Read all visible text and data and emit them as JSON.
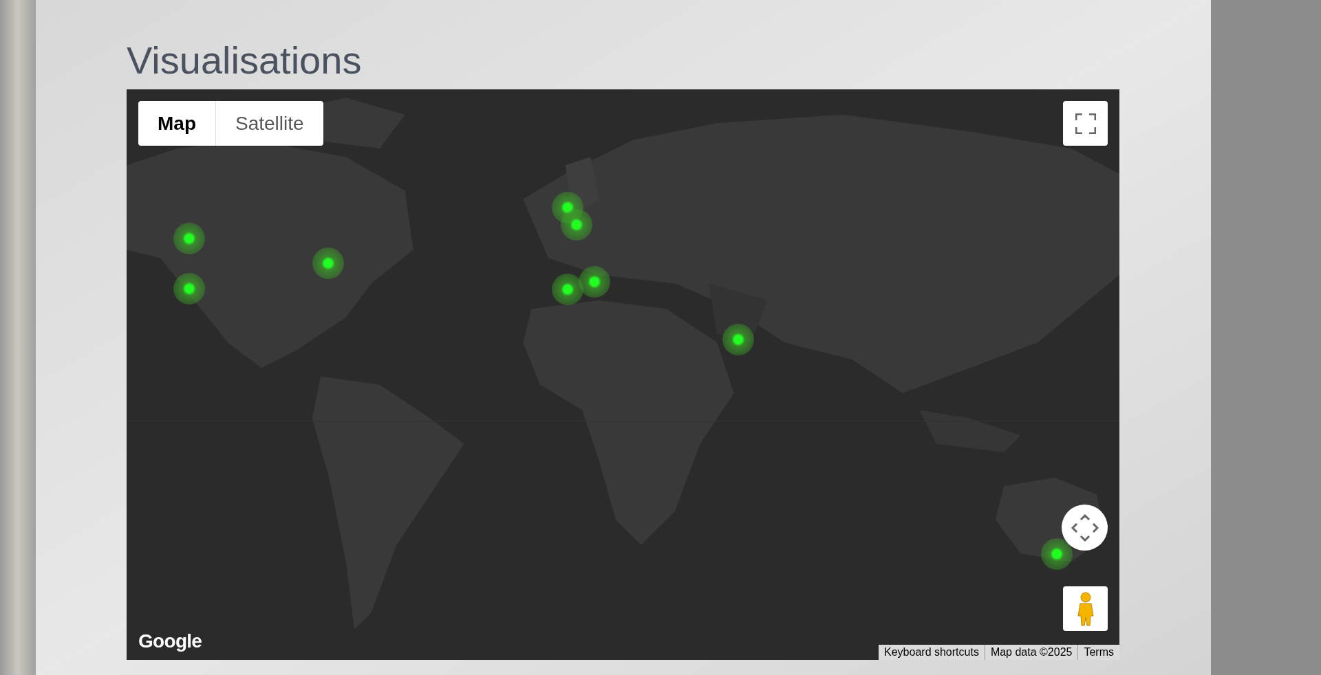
{
  "page": {
    "title": "Visualisations"
  },
  "map": {
    "map_type_tabs": [
      {
        "label": "Map",
        "selected": true
      },
      {
        "label": "Satellite",
        "selected": false
      }
    ],
    "logo": "Google",
    "footer_links": [
      "Keyboard shortcuts",
      "Map data ©2025",
      "Terms"
    ]
  }
}
